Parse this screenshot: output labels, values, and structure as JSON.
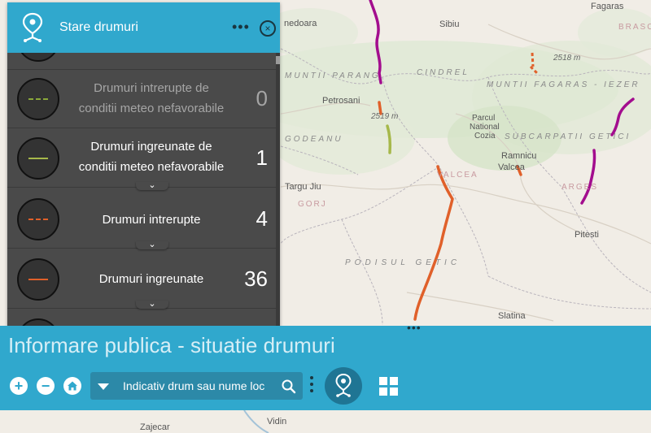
{
  "panel": {
    "title": "Stare drumuri",
    "more_label": "•••",
    "close_label": "×"
  },
  "legend": [
    {
      "label": "Drumuri intrerupte de conditii meteo nefavorabile",
      "count": "0",
      "line_color": "#8aa83a",
      "line_style": "dashed",
      "dimmed": true
    },
    {
      "label": "Drumuri ingreunate de conditii meteo nefavorabile",
      "count": "1",
      "line_color": "#a6b84a",
      "line_style": "solid",
      "dimmed": false
    },
    {
      "label": "Drumuri intrerupte",
      "count": "4",
      "line_color": "#e0602a",
      "line_style": "dashed",
      "dimmed": false
    },
    {
      "label": "Drumuri ingreunate",
      "count": "36",
      "line_color": "#e0602a",
      "line_style": "solid",
      "dimmed": false
    }
  ],
  "bottom_bar": {
    "title": "Informare publica - situatie drumuri",
    "handle_label": "•••",
    "zoom_in_label": "+",
    "zoom_out_label": "−",
    "search_placeholder": "Indicativ drum sau nume loc"
  },
  "map": {
    "labels": {
      "fagaras": "Fagaras",
      "brasov": "BRASOV",
      "sibiu": "Sibiu",
      "hunedoara": "nedoara",
      "muntii_parang": "MUNTII PARANG",
      "cindrel": "CINDREL",
      "muntii_fagaras": "MUNTII FAGARAS - IEZER",
      "elev_1": "2518 m",
      "elev_2": "2519 m",
      "petrosani": "Petrosani",
      "parcul_1": "Parcul",
      "parcul_2": "National",
      "parcul_3": "Cozia",
      "subcarpatii": "SUBCARPATII GETICI",
      "godeanu": "GODEANU",
      "ramnicu_1": "Ramnicu",
      "ramnicu_2": "Valcea",
      "valcea": "VALCEA",
      "arges": "ARGES",
      "targu_jiu": "Targu Jiu",
      "gorj": "GORJ",
      "pitesti": "Pitesti",
      "podisul": "PODISUL  GETIC",
      "slatina": "Slatina",
      "zajecar": "Zajecar",
      "vidin": "Vidin"
    },
    "road_colors": {
      "blocked": "#a30d8e",
      "difficult": "#e0602a",
      "weather": "#a6b84a"
    }
  },
  "colors": {
    "accent": "#30a8cd",
    "panel_bg": "#4a4a4a"
  },
  "icons": {
    "roads_widget": "road-status-pin-icon",
    "grid": "app-grid-icon",
    "search": "search-icon",
    "home": "home-icon"
  }
}
